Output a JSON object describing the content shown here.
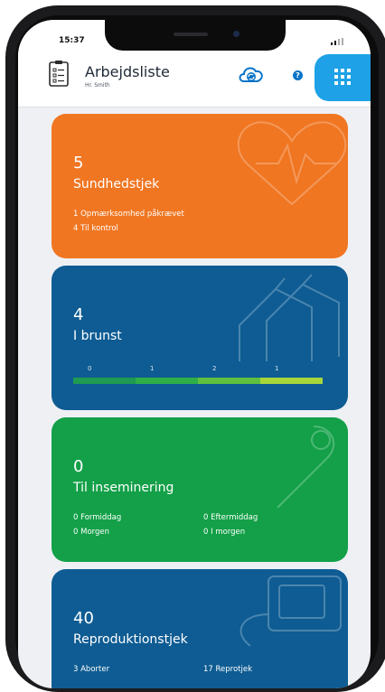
{
  "status": {
    "time": "15:37"
  },
  "header": {
    "title": "Arbejdsliste",
    "subtitle": "Hr. Smith",
    "help_label": "?"
  },
  "cards": [
    {
      "id": "sundhed",
      "count": "5",
      "label": "Sundhedstjek",
      "lines": [
        "1 Opmærksomhed påkrævet",
        "4 Til kontrol"
      ],
      "color": "#f07622"
    },
    {
      "id": "brunst",
      "count": "4",
      "label": "I brunst",
      "bar_values": [
        "0",
        "1",
        "2",
        "1"
      ],
      "color": "#0e5c93"
    },
    {
      "id": "insemination",
      "count": "0",
      "label": "Til inseminering",
      "left_lines": [
        "0 Formiddag",
        "0 Morgen"
      ],
      "right_lines": [
        "0 Eftermiddag",
        "0 I morgen"
      ],
      "color": "#13a048"
    },
    {
      "id": "reproduktion",
      "count": "40",
      "label": "Reproduktionstjek",
      "left_lines": [
        "3 Aborter"
      ],
      "right_lines": [
        "17 Reprotjek"
      ],
      "color": "#0e5c93"
    }
  ],
  "icons": {
    "header_left": "clipboard-icon",
    "cloud": "cloud-sync-icon",
    "help": "help-icon",
    "apps": "apps-grid-icon"
  }
}
